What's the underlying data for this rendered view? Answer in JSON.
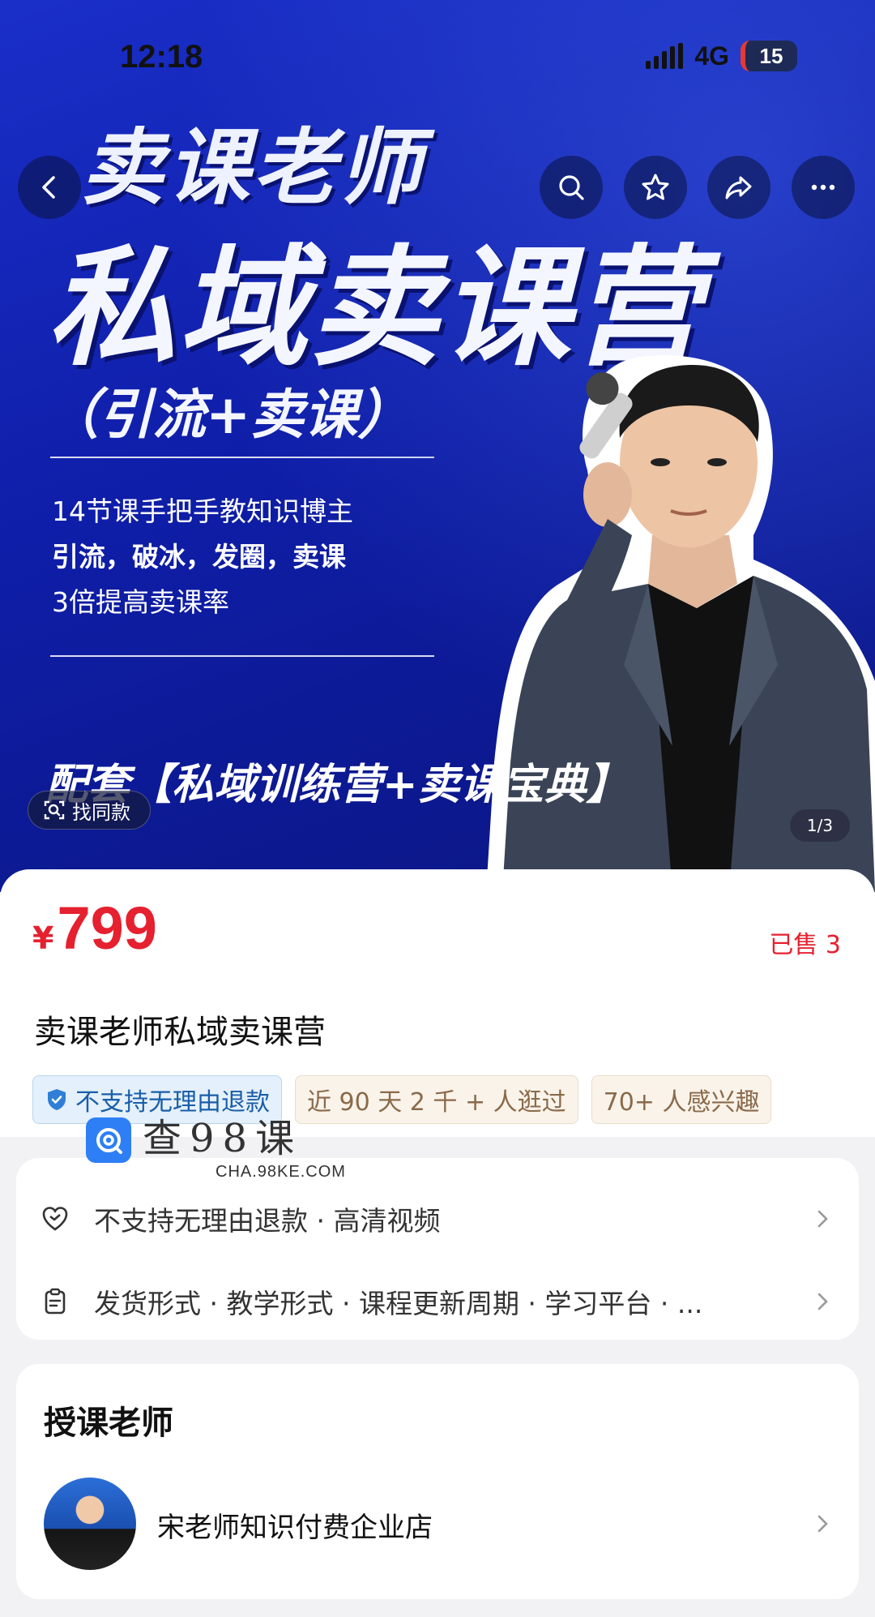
{
  "status_bar": {
    "time": "12:18",
    "network": "4G",
    "battery": "15"
  },
  "banner": {
    "headline_top": "卖课老师",
    "headline_main": "私域卖课营",
    "headline_sub": "（引流+卖课）",
    "bullets": [
      "14节课手把手教知识博主",
      "引流，破冰，发圈，卖课",
      "3倍提高卖课率"
    ],
    "bottom_text": "配套【私域训练营+卖课宝典】",
    "find_similar_label": "找同款",
    "page_indicator": "1/3",
    "accent_color": "#1428b8"
  },
  "nav": {
    "icons": [
      "back-icon",
      "search-icon",
      "star-icon",
      "share-icon",
      "more-icon"
    ]
  },
  "product": {
    "currency": "¥",
    "price": "799",
    "sold_label": "已售 3",
    "title": "卖课老师私域卖课营",
    "tags": [
      {
        "label": "不支持无理由退款",
        "style": "blue",
        "icon": "shield-check-icon"
      },
      {
        "label": "近 90 天 2 千 + 人逛过",
        "style": "beige"
      },
      {
        "label": "70+ 人感兴趣",
        "style": "beige"
      }
    ],
    "price_color": "#e5202f"
  },
  "watermark": {
    "main": "查98课",
    "sub": "CHA.98KE.COM"
  },
  "services": {
    "rows": [
      {
        "icon": "heart-shield-icon",
        "text": "不支持无理由退款 · 高清视频"
      },
      {
        "icon": "clipboard-icon",
        "text": "发货形式 · 教学形式 · 课程更新周期 · 学习平台 · ..."
      }
    ]
  },
  "teacher": {
    "heading": "授课老师",
    "shop_name": "宋老师知识付费企业店"
  }
}
